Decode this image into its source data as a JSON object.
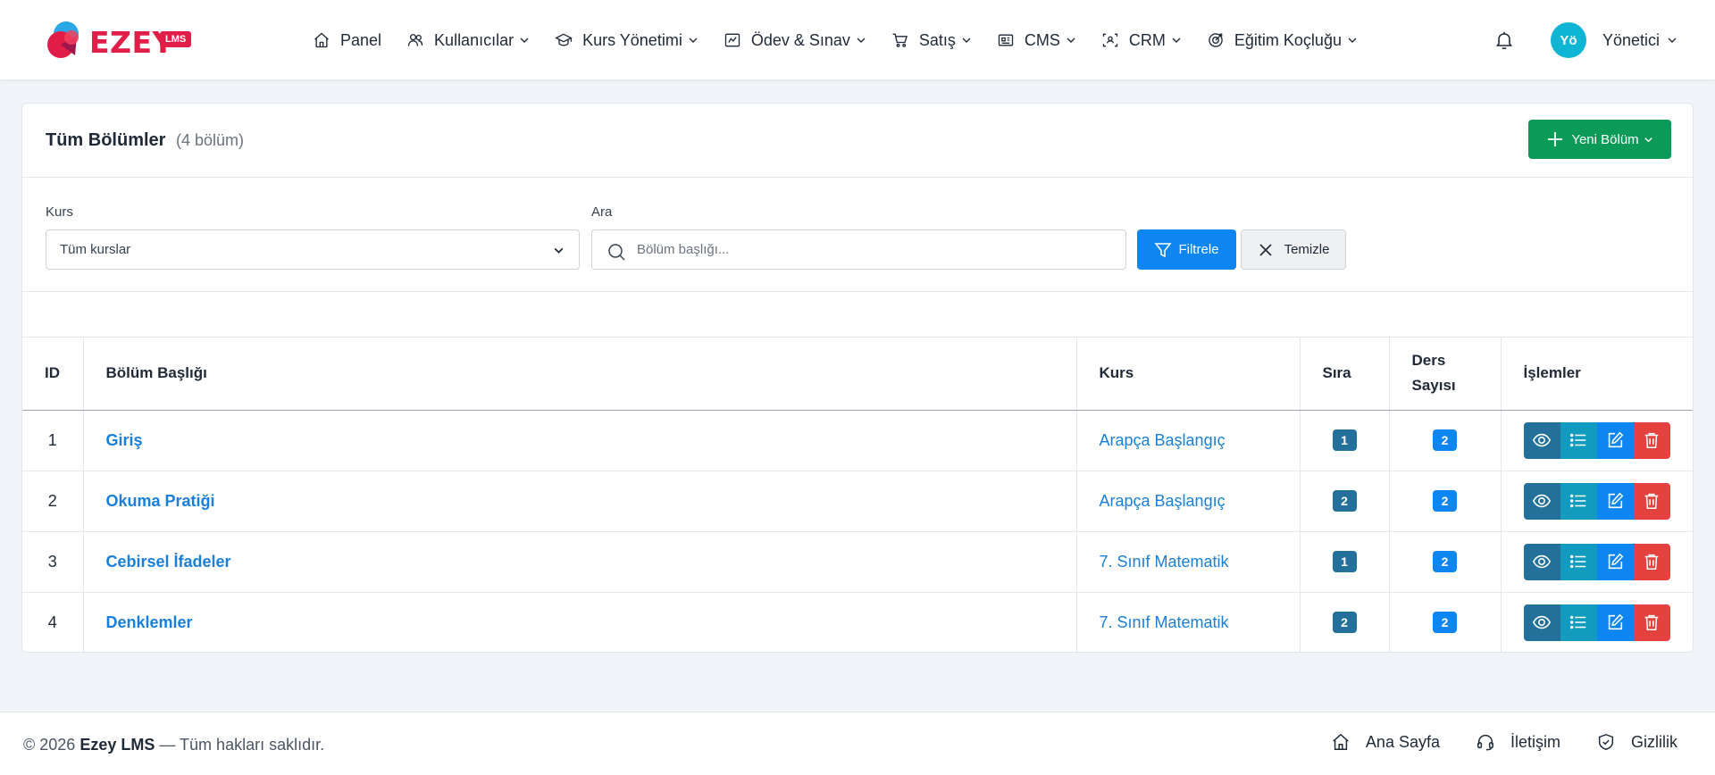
{
  "brand": {
    "name": "EZEY",
    "badge": "LMS",
    "accent": "#e11d48"
  },
  "nav": {
    "items": [
      {
        "label": "Panel",
        "icon": "home-icon"
      },
      {
        "label": "Kullanıcılar",
        "icon": "users-icon"
      },
      {
        "label": "Kurs Yönetimi",
        "icon": "graduation-cap-icon"
      },
      {
        "label": "Ödev & Sınav",
        "icon": "chart-icon"
      },
      {
        "label": "Satış",
        "icon": "cart-icon"
      },
      {
        "label": "CMS",
        "icon": "newspaper-icon"
      },
      {
        "label": "CRM",
        "icon": "user-scan-icon"
      },
      {
        "label": "Eğitim Koçluğu",
        "icon": "target-icon"
      }
    ]
  },
  "user": {
    "initials": "Yö",
    "name": "Yönetici"
  },
  "card": {
    "title": "Tüm Bölümler",
    "count": "(4 bölüm)",
    "new_button": "Yeni Bölüm"
  },
  "filters": {
    "course_label": "Kurs",
    "course_value": "Tüm kurslar",
    "search_label": "Ara",
    "search_placeholder": "Bölüm başlığı...",
    "filter_button": "Filtrele",
    "clear_button": "Temizle"
  },
  "table": {
    "headers": {
      "id": "ID",
      "title": "Bölüm Başlığı",
      "course": "Kurs",
      "order": "Sıra",
      "lesson_count_line1": "Ders",
      "lesson_count_line2": "Sayısı",
      "actions": "İşlemler"
    },
    "rows": [
      {
        "id": "1",
        "title": "Giriş",
        "course": "Arapça Başlangıç",
        "order": "1",
        "lessons": "2"
      },
      {
        "id": "2",
        "title": "Okuma Pratiği",
        "course": "Arapça Başlangıç",
        "order": "2",
        "lessons": "2"
      },
      {
        "id": "3",
        "title": "Cebirsel İfadeler",
        "course": "7. Sınıf Matematik",
        "order": "1",
        "lessons": "2"
      },
      {
        "id": "4",
        "title": "Denklemler",
        "course": "7. Sınıf Matematik",
        "order": "2",
        "lessons": "2"
      }
    ]
  },
  "footer": {
    "copyright_prefix": "© 2026",
    "copyright_brand": "Ezey LMS",
    "copyright_suffix": "— Tüm hakları saklıdır.",
    "links": [
      {
        "label": "Ana Sayfa",
        "icon": "home-icon"
      },
      {
        "label": "İletişim",
        "icon": "headset-icon"
      },
      {
        "label": "Gizlilik",
        "icon": "shield-check-icon"
      }
    ]
  },
  "colors": {
    "primary": "#0d86f2",
    "success": "#0b9a58",
    "danger": "#e5413f",
    "info": "#139bbf",
    "dark_teal": "#23709b"
  }
}
